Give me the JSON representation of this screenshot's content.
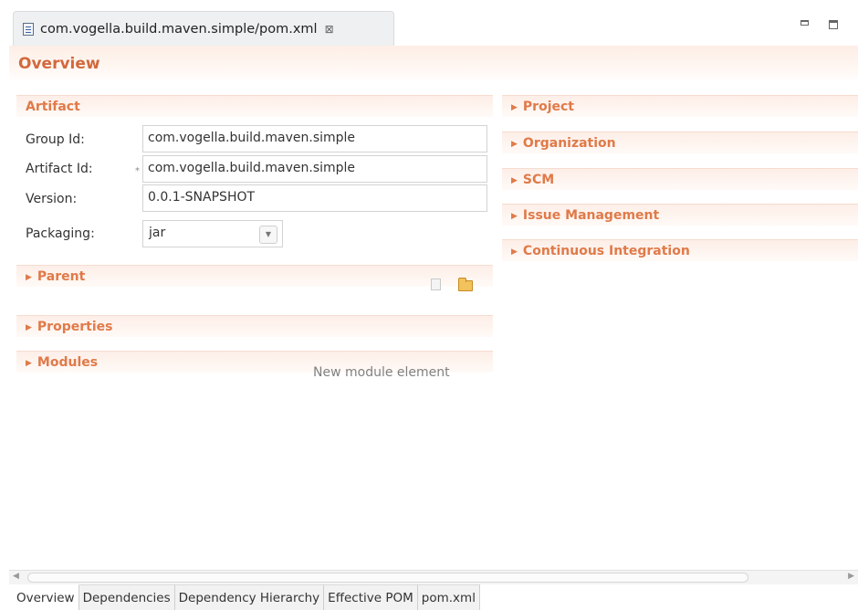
{
  "editor_tab": {
    "title": "com.vogella.build.maven.simple/pom.xml",
    "close_glyph": "⊠"
  },
  "overview": {
    "title": "Overview"
  },
  "artifact": {
    "title": "Artifact",
    "group_id_label": "Group Id:",
    "group_id_value": "com.vogella.build.maven.simple",
    "artifact_id_label": "Artifact Id:",
    "artifact_id_value": "com.vogella.build.maven.simple",
    "version_label": "Version:",
    "version_value": "0.0.1-SNAPSHOT",
    "packaging_label": "Packaging:",
    "packaging_value": "jar",
    "required_marker": "*"
  },
  "left_sections": {
    "parent": "Parent",
    "properties": "Properties",
    "modules": "Modules",
    "modules_hint": "New module element"
  },
  "right_sections": [
    "Project",
    "Organization",
    "SCM",
    "Issue Management",
    "Continuous Integration"
  ],
  "page_tabs": [
    "Overview",
    "Dependencies",
    "Dependency Hierarchy",
    "Effective POM",
    "pom.xml"
  ],
  "icons": [
    "file-xml-icon",
    "close-icon",
    "minimize-icon",
    "maximize-icon",
    "new-document-icon",
    "open-folder-icon",
    "expand-arrow-icon",
    "dropdown-arrow-icon",
    "scroll-left-icon",
    "scroll-right-icon"
  ],
  "colors": {
    "section_title": "#e07a49",
    "overview_title": "#d2683c"
  }
}
